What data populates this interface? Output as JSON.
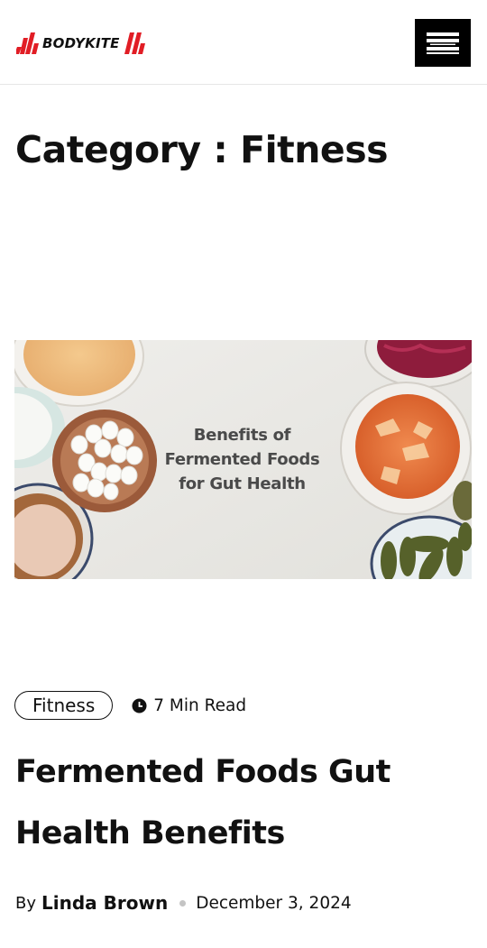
{
  "header": {
    "logo_text": "BODYKITE",
    "brand_color": "#e11d25",
    "menu_icon": "hamburger-icon"
  },
  "page": {
    "title": "Category : Fitness"
  },
  "post": {
    "image_caption": "Benefits of\nFermented Foods\nfor Gut Health",
    "category": "Fitness",
    "read_time": "7 Min Read",
    "title": "Fermented Foods Gut Health Benefits",
    "by_label": "By",
    "author": "Linda Brown",
    "date": "December 3, 2024"
  }
}
